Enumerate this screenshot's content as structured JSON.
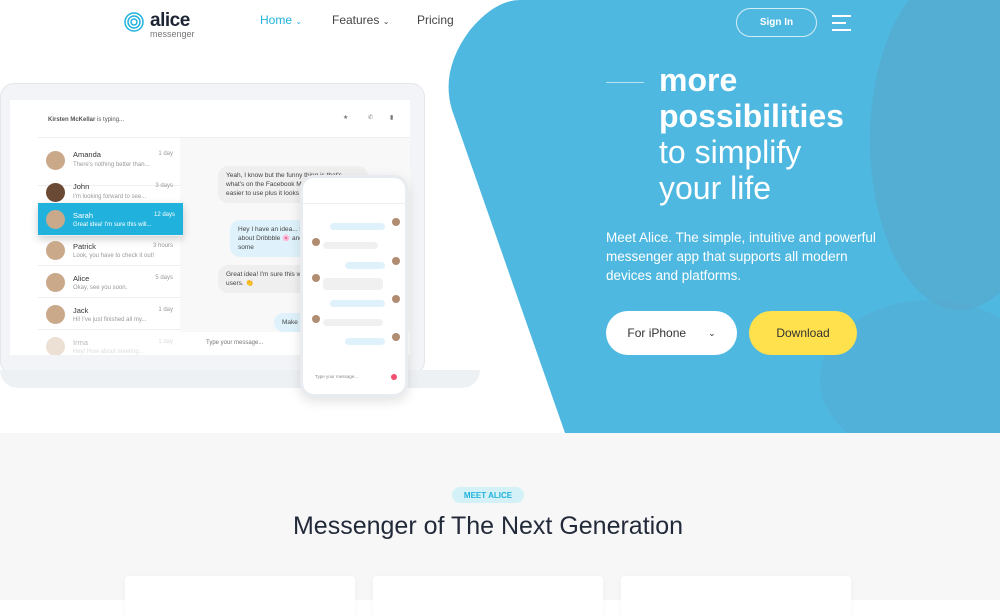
{
  "brand": {
    "name": "alice",
    "sub": "messenger",
    "accent": "#20b2dc",
    "hero_blue": "#4fb8e0",
    "cta_yellow": "#ffe04d"
  },
  "nav": {
    "items": [
      {
        "label": "Home",
        "icon": "chevron-down-icon"
      },
      {
        "label": "Features",
        "icon": "chevron-down-icon"
      },
      {
        "label": "Pricing"
      }
    ],
    "signin": "Sign In",
    "menu_icon": "hamburger-icon"
  },
  "hero": {
    "line1": "more",
    "line2": "possibilities",
    "line3": "to simplify",
    "line4": "your life",
    "description": "Meet Alice. The simple, intuitive and powerful messenger app that supports all modern devices and platforms.",
    "platform_select": "For iPhone",
    "download": "Download"
  },
  "app": {
    "typing_name": "Kirsten McKellar",
    "typing_suffix": " is typing...",
    "contacts": [
      {
        "name": "Amanda",
        "preview": "There's nothing better than...",
        "time": "1 day"
      },
      {
        "name": "John",
        "preview": "I'm looking forward to see...",
        "time": "3 days"
      },
      {
        "name": "Sarah",
        "preview": "Great idea! I'm sure this will...",
        "time": "12 days"
      },
      {
        "name": "Patrick",
        "preview": "Look, you have to check it out!",
        "time": "3 hours"
      },
      {
        "name": "Alice",
        "preview": "Okay, see you soon.",
        "time": "5 days"
      },
      {
        "name": "Jack",
        "preview": "Hi! I've just finished all my...",
        "time": "1 day"
      },
      {
        "name": "Irma",
        "preview": "Hey! How about meeting...",
        "time": "1 day"
      }
    ],
    "messages": [
      {
        "text": "Yeah, I know but the funny thing is that's what's on the Facebook Messenger app and... easier to use plus it looks pretty"
      },
      {
        "text": "Hey I have an idea... How about Dribbble 🌸 and get some"
      },
      {
        "text": "Great idea! I'm sure this will be users. 👏"
      },
      {
        "text": "Make sur"
      }
    ],
    "input_placeholder": "Type your message..."
  },
  "section": {
    "badge": "MEET ALICE",
    "title": "Messenger of The Next Generation"
  }
}
